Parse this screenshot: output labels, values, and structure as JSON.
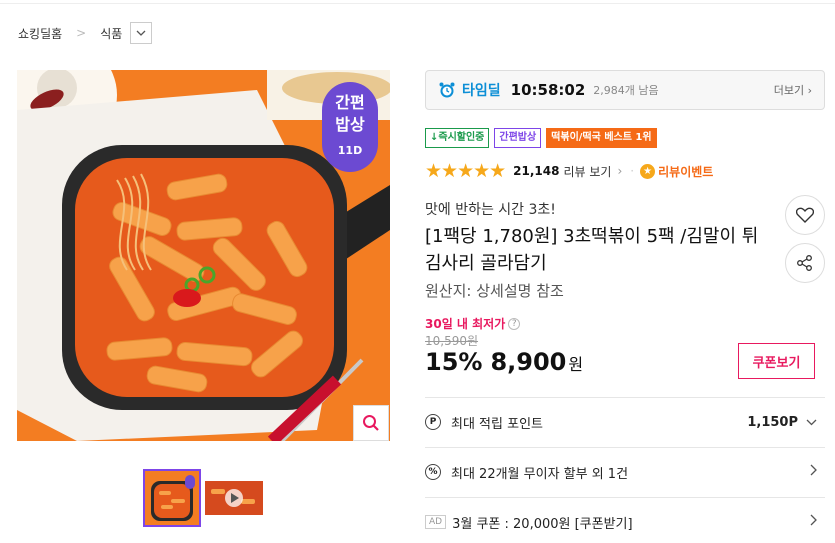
{
  "breadcrumb": {
    "home": "쇼킹딜홈",
    "category": "식품"
  },
  "main_image": {
    "badge_line1": "간편",
    "badge_line2": "밥상",
    "badge_brand": "11D"
  },
  "timedeal": {
    "label": "타임딜",
    "time": "10:58:02",
    "remaining": "2,984개 남음",
    "more": "더보기"
  },
  "tags": [
    {
      "label": "↓즉시할인중",
      "style": "green"
    },
    {
      "label": "간편밥상",
      "style": "purple"
    },
    {
      "label": "떡볶이/떡국 베스트 1위",
      "style": "orange"
    }
  ],
  "rating": {
    "stars": "★★★★★",
    "count": "21,148",
    "review_label": "리뷰 보기",
    "event_label": "리뷰이벤트",
    "score": 4.6
  },
  "product": {
    "subtitle": "맛에 반하는 시간 3초!",
    "title": "[1팩당 1,780원] 3초떡볶이 5팩 /김말이 튀김사리 골라담기",
    "origin": "원산지: 상세설명 참조"
  },
  "price": {
    "lowest_label": "30일 내 최저가",
    "original": "10,590원",
    "discount": "15%",
    "final": "8,900",
    "won": "원",
    "coupon_button": "쿠폰보기"
  },
  "info_rows": [
    {
      "icon": "P",
      "label": "최대 적립 포인트",
      "value": "1,150P"
    },
    {
      "icon": "%",
      "label": "최대 22개월 무이자 할부 외 1건"
    },
    {
      "ad": "AD",
      "label": "3월 쿠폰 : 20,000원 [쿠폰받기]"
    }
  ],
  "colors": {
    "accent": "#e8195f",
    "timedeal": "#0d8fd6",
    "brand_purple": "#7d45e8",
    "orange": "#f56a16"
  }
}
